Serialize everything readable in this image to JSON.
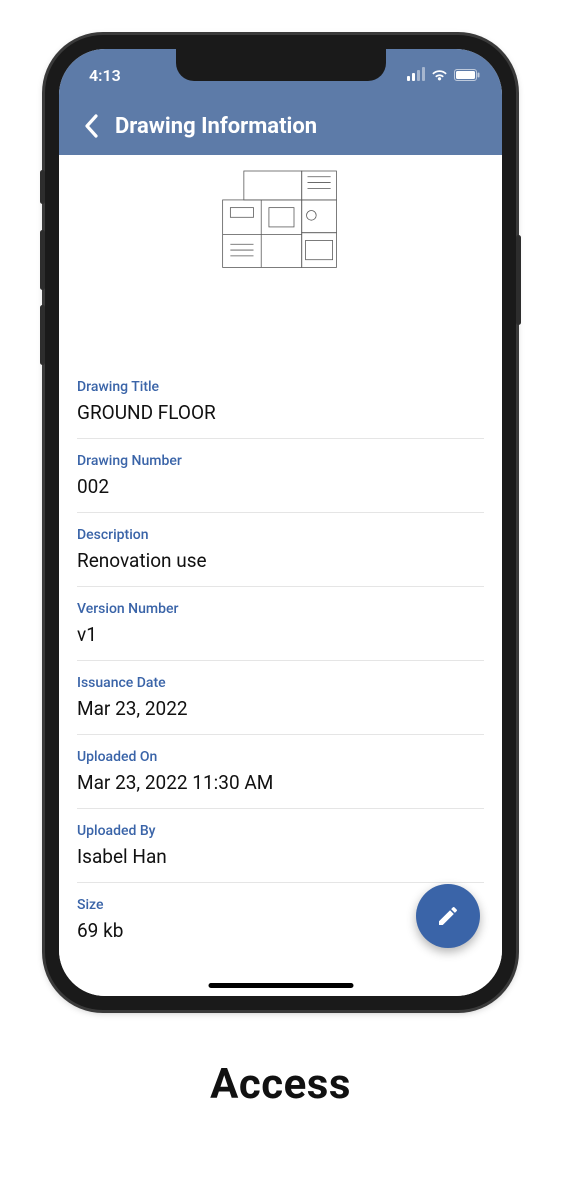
{
  "status": {
    "time": "4:13"
  },
  "header": {
    "title": "Drawing Information"
  },
  "fields": {
    "drawing_title": {
      "label": "Drawing Title",
      "value": "GROUND FLOOR"
    },
    "drawing_number": {
      "label": "Drawing Number",
      "value": "002"
    },
    "description": {
      "label": "Description",
      "value": "Renovation use"
    },
    "version_number": {
      "label": "Version Number",
      "value": "v1"
    },
    "issuance_date": {
      "label": "Issuance Date",
      "value": "Mar 23, 2022"
    },
    "uploaded_on": {
      "label": "Uploaded On",
      "value": "Mar 23, 2022 11:30 AM"
    },
    "uploaded_by": {
      "label": "Uploaded By",
      "value": "Isabel Han"
    },
    "size": {
      "label": "Size",
      "value": "69 kb"
    }
  },
  "caption": "Access",
  "icons": {
    "back": "chevron-left-icon",
    "fab": "pencil-icon",
    "signal": "signal-icon",
    "wifi": "wifi-icon",
    "battery": "battery-icon"
  },
  "colors": {
    "accent": "#3a64a8",
    "header_bg": "#5d7ba8",
    "label": "#3a64a8"
  }
}
